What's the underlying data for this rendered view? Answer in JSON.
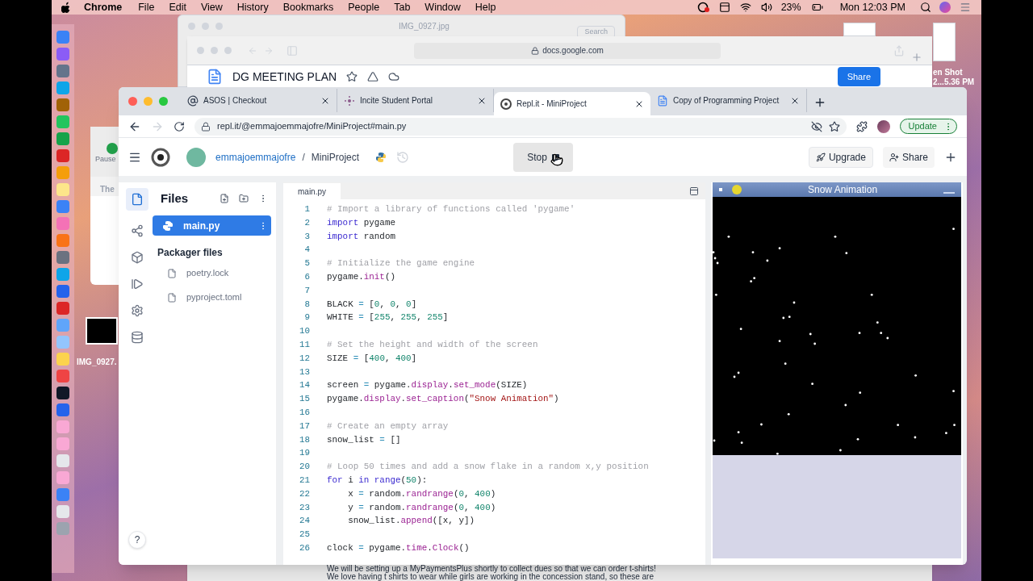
{
  "menubar": {
    "app": "Chrome",
    "menus": [
      "File",
      "Edit",
      "View",
      "History",
      "Bookmarks",
      "People",
      "Tab",
      "Window",
      "Help"
    ],
    "battery": "23%",
    "clock": "Mon 12:03 PM"
  },
  "desktop": {
    "labels": [
      "IMG_0927.",
      "en Shot",
      "2...5.36 PM"
    ]
  },
  "preview_window": {
    "title": "IMG_0927.jpg",
    "search_placeholder": "Search"
  },
  "back_window": {
    "button": "Pause",
    "text": "The"
  },
  "docs_window": {
    "url": "docs.google.com",
    "doc_title": "DG MEETING PLAN",
    "share": "Share",
    "body_lines": [
      "We will be setting up a MyPaymentsPlus shortly to collect dues so that we can order t-shirts!",
      "We love having t shirts to wear while girls are working in the concession stand, so these are"
    ]
  },
  "browser": {
    "tabs": [
      {
        "title": "ASOS | Checkout",
        "selected": false,
        "kind": "at"
      },
      {
        "title": "Incite Student Portal",
        "selected": false,
        "kind": "dots"
      },
      {
        "title": "Repl.it - MiniProject",
        "selected": true,
        "kind": "replit"
      },
      {
        "title": "Copy of Programming Project",
        "selected": false,
        "kind": "doc"
      }
    ],
    "url": "repl.it/@emmajoemmajofre/MiniProject#main.py",
    "update": "Update"
  },
  "header": {
    "user": "emmajoemmajofre",
    "separator": "/",
    "project": "MiniProject",
    "stop": "Stop",
    "upgrade": "Upgrade",
    "share": "Share"
  },
  "files": {
    "title": "Files",
    "items": [
      {
        "name": "main.py",
        "selected": true
      }
    ],
    "section": "Packager files",
    "packager_items": [
      "poetry.lock",
      "pyproject.toml"
    ],
    "help": "?"
  },
  "editor": {
    "tab": "main.py",
    "lines": [
      {
        "n": "1",
        "tokens": [
          {
            "kind": "comment",
            "text": "# Import a library of functions called 'pygame'"
          }
        ]
      },
      {
        "n": "2",
        "tokens": [
          {
            "kind": "keyword",
            "text": "import"
          },
          {
            "kind": "plain",
            "text": " pygame"
          }
        ]
      },
      {
        "n": "3",
        "tokens": [
          {
            "kind": "keyword",
            "text": "import"
          },
          {
            "kind": "plain",
            "text": " random"
          }
        ]
      },
      {
        "n": "4"
      },
      {
        "n": "5",
        "tokens": [
          {
            "kind": "comment",
            "text": "# Initialize the game engine"
          }
        ]
      },
      {
        "n": "6",
        "tokens": [
          {
            "kind": "plain",
            "text": "pygame."
          },
          {
            "kind": "func",
            "text": "init"
          },
          {
            "kind": "plain",
            "text": "()"
          }
        ]
      },
      {
        "n": "7"
      },
      {
        "n": "8",
        "tokens": [
          {
            "kind": "plain",
            "text": "BLACK "
          },
          {
            "kind": "op",
            "text": "="
          },
          {
            "kind": "plain",
            "text": " ["
          },
          {
            "kind": "number",
            "text": "0"
          },
          {
            "kind": "plain",
            "text": ", "
          },
          {
            "kind": "number",
            "text": "0"
          },
          {
            "kind": "plain",
            "text": ", "
          },
          {
            "kind": "number",
            "text": "0"
          },
          {
            "kind": "plain",
            "text": "]"
          }
        ]
      },
      {
        "n": "9",
        "tokens": [
          {
            "kind": "plain",
            "text": "WHITE "
          },
          {
            "kind": "op",
            "text": "="
          },
          {
            "kind": "plain",
            "text": " ["
          },
          {
            "kind": "number",
            "text": "255"
          },
          {
            "kind": "plain",
            "text": ", "
          },
          {
            "kind": "number",
            "text": "255"
          },
          {
            "kind": "plain",
            "text": ", "
          },
          {
            "kind": "number",
            "text": "255"
          },
          {
            "kind": "plain",
            "text": "]"
          }
        ]
      },
      {
        "n": "10"
      },
      {
        "n": "11",
        "tokens": [
          {
            "kind": "comment",
            "text": "# Set the height and width of the screen"
          }
        ]
      },
      {
        "n": "12",
        "tokens": [
          {
            "kind": "plain",
            "text": "SIZE "
          },
          {
            "kind": "op",
            "text": "="
          },
          {
            "kind": "plain",
            "text": " ["
          },
          {
            "kind": "number",
            "text": "400"
          },
          {
            "kind": "plain",
            "text": ", "
          },
          {
            "kind": "number",
            "text": "400"
          },
          {
            "kind": "plain",
            "text": "]"
          }
        ]
      },
      {
        "n": "13"
      },
      {
        "n": "14",
        "tokens": [
          {
            "kind": "plain",
            "text": "screen "
          },
          {
            "kind": "op",
            "text": "="
          },
          {
            "kind": "plain",
            "text": " pygame."
          },
          {
            "kind": "func",
            "text": "display"
          },
          {
            "kind": "plain",
            "text": "."
          },
          {
            "kind": "func",
            "text": "set_mode"
          },
          {
            "kind": "plain",
            "text": "(SIZE)"
          }
        ]
      },
      {
        "n": "15",
        "tokens": [
          {
            "kind": "plain",
            "text": "pygame."
          },
          {
            "kind": "func",
            "text": "display"
          },
          {
            "kind": "plain",
            "text": "."
          },
          {
            "kind": "func",
            "text": "set_caption"
          },
          {
            "kind": "plain",
            "text": "("
          },
          {
            "kind": "string",
            "text": "\"Snow Animation\""
          },
          {
            "kind": "plain",
            "text": ")"
          }
        ]
      },
      {
        "n": "16"
      },
      {
        "n": "17",
        "tokens": [
          {
            "kind": "comment",
            "text": "# Create an empty array"
          }
        ]
      },
      {
        "n": "18",
        "tokens": [
          {
            "kind": "plain",
            "text": "snow_list "
          },
          {
            "kind": "op",
            "text": "="
          },
          {
            "kind": "plain",
            "text": " []"
          }
        ]
      },
      {
        "n": "19"
      },
      {
        "n": "20",
        "tokens": [
          {
            "kind": "comment",
            "text": "# Loop 50 times and add a snow flake in a random x,y position"
          }
        ]
      },
      {
        "n": "21",
        "tokens": [
          {
            "kind": "keyword",
            "text": "for"
          },
          {
            "kind": "plain",
            "text": " i "
          },
          {
            "kind": "keyword",
            "text": "in range"
          },
          {
            "kind": "plain",
            "text": "("
          },
          {
            "kind": "number",
            "text": "50"
          },
          {
            "kind": "plain",
            "text": "):"
          }
        ]
      },
      {
        "n": "22",
        "tokens": [
          {
            "kind": "plain",
            "text": "    x "
          },
          {
            "kind": "op",
            "text": "="
          },
          {
            "kind": "plain",
            "text": " random."
          },
          {
            "kind": "func",
            "text": "randrange"
          },
          {
            "kind": "plain",
            "text": "("
          },
          {
            "kind": "number",
            "text": "0"
          },
          {
            "kind": "plain",
            "text": ", "
          },
          {
            "kind": "number",
            "text": "400"
          },
          {
            "kind": "plain",
            "text": ")"
          }
        ]
      },
      {
        "n": "23",
        "tokens": [
          {
            "kind": "plain",
            "text": "    y "
          },
          {
            "kind": "op",
            "text": "="
          },
          {
            "kind": "plain",
            "text": " random."
          },
          {
            "kind": "func",
            "text": "randrange"
          },
          {
            "kind": "plain",
            "text": "("
          },
          {
            "kind": "number",
            "text": "0"
          },
          {
            "kind": "plain",
            "text": ", "
          },
          {
            "kind": "number",
            "text": "400"
          },
          {
            "kind": "plain",
            "text": ")"
          }
        ]
      },
      {
        "n": "24",
        "tokens": [
          {
            "kind": "plain",
            "text": "    snow_list."
          },
          {
            "kind": "func",
            "text": "append"
          },
          {
            "kind": "plain",
            "text": "([x, y])"
          }
        ]
      },
      {
        "n": "25"
      },
      {
        "n": "26",
        "tokens": [
          {
            "kind": "plain",
            "text": "clock "
          },
          {
            "kind": "op",
            "text": "="
          },
          {
            "kind": "plain",
            "text": " pygame."
          },
          {
            "kind": "func",
            "text": "time"
          },
          {
            "kind": "plain",
            "text": "."
          },
          {
            "kind": "func",
            "text": "Clock"
          },
          {
            "kind": "plain",
            "text": "()"
          }
        ]
      }
    ]
  },
  "output": {
    "title": "Snow Animation"
  }
}
